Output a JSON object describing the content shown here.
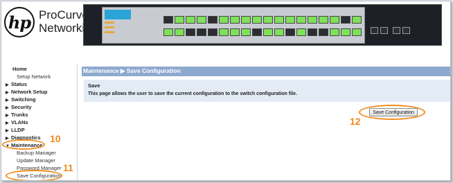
{
  "brand": {
    "logo": "hp",
    "line1": "ProCurve",
    "line2": "Networking"
  },
  "sidebar": {
    "home": "Home",
    "setup_network": "Setup Network",
    "status": "Status",
    "network_setup": "Network Setup",
    "switching": "Switching",
    "security": "Security",
    "trunks": "Trunks",
    "vlans": "VLANs",
    "lldp": "LLDP",
    "diagnostics": "Diagnostics",
    "maintenance": "Maintenance",
    "backup_manager": "Backup Manager",
    "update_manager": "Update Manager",
    "password_manager": "Password Manager",
    "save_configuration": "Save Configuration",
    "collapsed_arrow": "▶",
    "expanded_arrow": "▼"
  },
  "page": {
    "title": "Maintenance ▶ Save Configuration",
    "section_title": "Save",
    "description": "This page allows the user to save the current configuration to the switch configuration file.",
    "save_button": "Save Configuration"
  },
  "annotations": {
    "step10": "10",
    "step11": "11",
    "step12": "12"
  },
  "colors": {
    "accent": "#f08a1c",
    "title_bar": "#8ea9cf",
    "panel": "#e3ebf5",
    "port_active": "#7fe05a"
  }
}
